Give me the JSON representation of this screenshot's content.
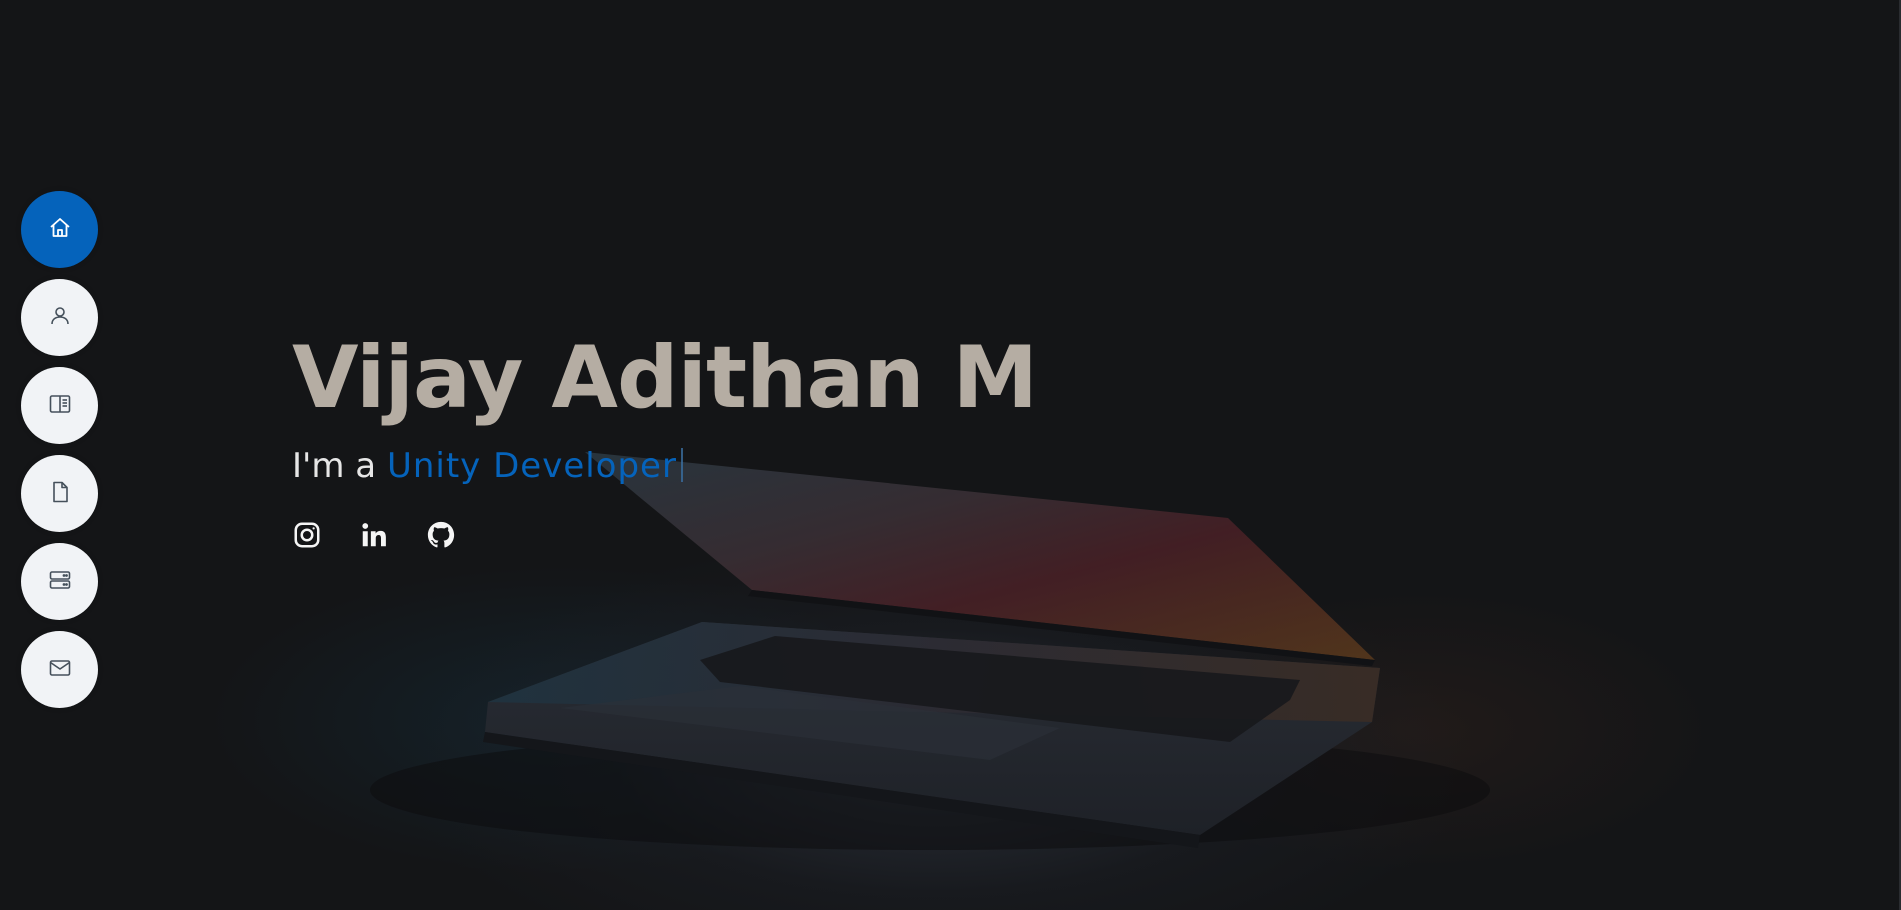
{
  "nav": {
    "items": [
      {
        "name": "home",
        "icon": "home-icon",
        "active": true
      },
      {
        "name": "about",
        "icon": "person-icon",
        "active": false
      },
      {
        "name": "resume",
        "icon": "book-icon",
        "active": false
      },
      {
        "name": "portfolio",
        "icon": "file-icon",
        "active": false
      },
      {
        "name": "services",
        "icon": "server-icon",
        "active": false
      },
      {
        "name": "contact",
        "icon": "envelope-icon",
        "active": false
      }
    ],
    "active_color": "#0563bb",
    "inactive_color": "#f1f3f6"
  },
  "hero": {
    "name": "Vijay Adithan M",
    "tagline_prefix": "I'm a ",
    "typed_role": "Unity Developer",
    "accent_color": "#0563bb",
    "name_color": "#b5ada3"
  },
  "social": [
    {
      "name": "instagram",
      "icon": "instagram-icon"
    },
    {
      "name": "linkedin",
      "icon": "linkedin-icon"
    },
    {
      "name": "github",
      "icon": "github-icon"
    }
  ]
}
